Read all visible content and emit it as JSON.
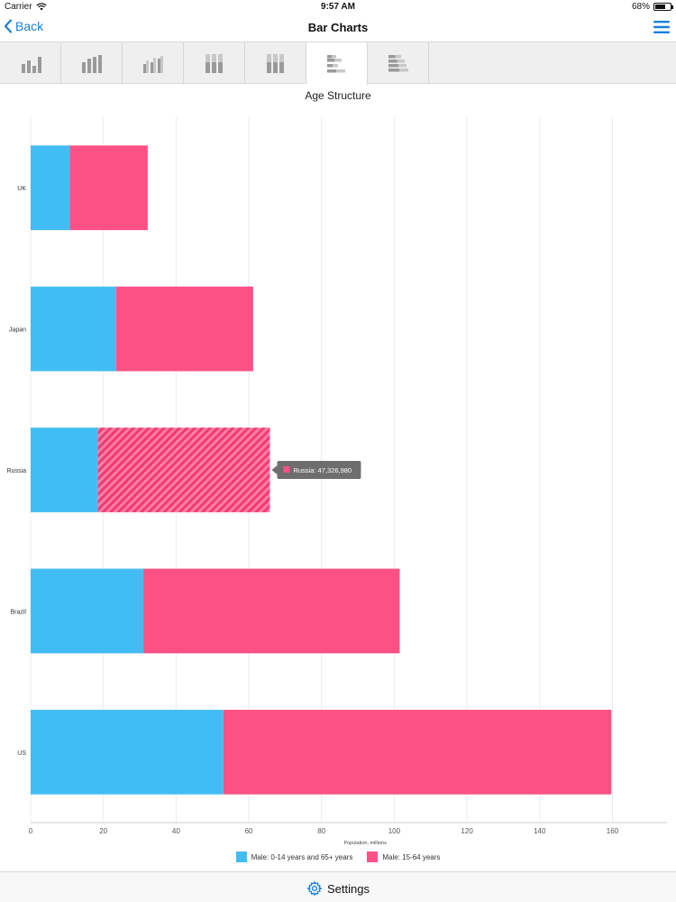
{
  "status_bar": {
    "carrier": "Carrier",
    "time": "9:57 AM",
    "battery": "68%",
    "battery_level": 0.68
  },
  "nav": {
    "back_label": "Back",
    "title": "Bar Charts"
  },
  "tabs": [
    {
      "icon": "column-chart-icon",
      "active": false
    },
    {
      "icon": "column-chart-icon",
      "active": false
    },
    {
      "icon": "grouped-column-chart-icon",
      "active": false
    },
    {
      "icon": "stacked-column-chart-icon",
      "active": false
    },
    {
      "icon": "stacked-column-chart-icon",
      "active": false
    },
    {
      "icon": "bar-chart-icon",
      "active": true
    },
    {
      "icon": "stacked-bar-chart-icon",
      "active": false
    }
  ],
  "colors": {
    "series_a": "#42bdf3",
    "series_b": "#fd5185",
    "accent": "#1a7fe0",
    "tooltip_bg": "#6e6e6e"
  },
  "chart_data": {
    "type": "bar",
    "orientation": "horizontal",
    "stacked": true,
    "title": "Age Structure",
    "xlabel": "Population, millions",
    "ylabel": "",
    "categories": [
      "UK",
      "Japan",
      "Russia",
      "Brazil",
      "US"
    ],
    "series": [
      {
        "name": "Male: 0-14 years and 65+ years",
        "values": [
          10.8,
          23.5,
          18.5,
          31,
          53
        ]
      },
      {
        "name": "Male: 15-64 years",
        "values": [
          21.4,
          37.7,
          47.3,
          70.5,
          106.7
        ]
      }
    ],
    "xlim": [
      0,
      175
    ],
    "xticks": [
      0,
      20,
      40,
      60,
      80,
      100,
      120,
      140,
      160
    ],
    "grid": true,
    "legend_position": "bottom",
    "highlight": {
      "category_index": 2,
      "series_index": 1
    },
    "tooltip": {
      "text": "Russia: 47,326,980"
    }
  },
  "footer": {
    "settings_label": "Settings"
  }
}
